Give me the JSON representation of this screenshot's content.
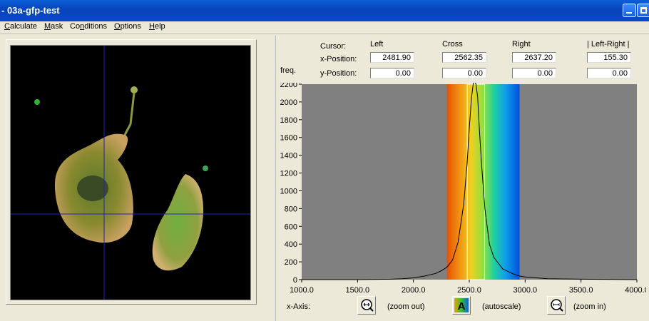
{
  "window": {
    "title": "- 03a-gfp-test"
  },
  "menu": [
    "Calculate",
    "Mask",
    "Conditions",
    "Options",
    "Help"
  ],
  "menu_mnemonics": [
    "C",
    "M",
    "n",
    "O",
    "H"
  ],
  "cursor_panel": {
    "cursor_label": "Cursor:",
    "columns": [
      "Left",
      "Cross",
      "Right",
      "| Left-Right |"
    ],
    "x_label": "x-Position:",
    "y_label": "y-Position:",
    "x_values": [
      "2481.90",
      "2562.35",
      "2637.20",
      "155.30"
    ],
    "y_values": [
      "0.00",
      "0.00",
      "0.00",
      "0.00"
    ]
  },
  "chart_data": {
    "type": "line",
    "ylabel": "freq.",
    "xlabel": "",
    "xlim": [
      1000,
      4000
    ],
    "ylim": [
      0,
      2200
    ],
    "x_ticks": [
      "1000.0",
      "1500.0",
      "2000.0",
      "2500.0",
      "3000.0",
      "3500.0",
      "4000.0"
    ],
    "y_ticks": [
      "0",
      "200",
      "400",
      "600",
      "800",
      "1000",
      "1200",
      "1400",
      "1600",
      "1800",
      "2000",
      "2200"
    ],
    "selection_range": [
      2300,
      2950
    ],
    "cursor_lines": [
      2481.9,
      2637.2
    ],
    "series": [
      {
        "x": [
          1000,
          1500,
          1800,
          1900,
          2000,
          2100,
          2200,
          2250,
          2300,
          2350,
          2400,
          2450,
          2480,
          2500,
          2520,
          2540,
          2560,
          2575,
          2590,
          2610,
          2640,
          2680,
          2720,
          2800,
          2900,
          2950,
          3000,
          3100,
          3200,
          3500,
          4000
        ],
        "y": [
          0,
          0,
          5,
          10,
          20,
          40,
          70,
          100,
          140,
          220,
          420,
          850,
          1300,
          1700,
          2050,
          2250,
          2200,
          2050,
          1700,
          1300,
          800,
          400,
          250,
          120,
          60,
          40,
          30,
          20,
          10,
          5,
          0
        ]
      }
    ]
  },
  "xaxis_controls": {
    "label": "x-Axis:",
    "zoom_out": "(zoom out)",
    "autoscale": "(autoscale)",
    "zoom_in": "(zoom in)",
    "autoscale_icon_letter": "A"
  },
  "icons": {
    "zoom_out": "magnifier-out-icon",
    "autoscale": "autoscale-icon",
    "zoom_in": "magnifier-in-icon"
  }
}
